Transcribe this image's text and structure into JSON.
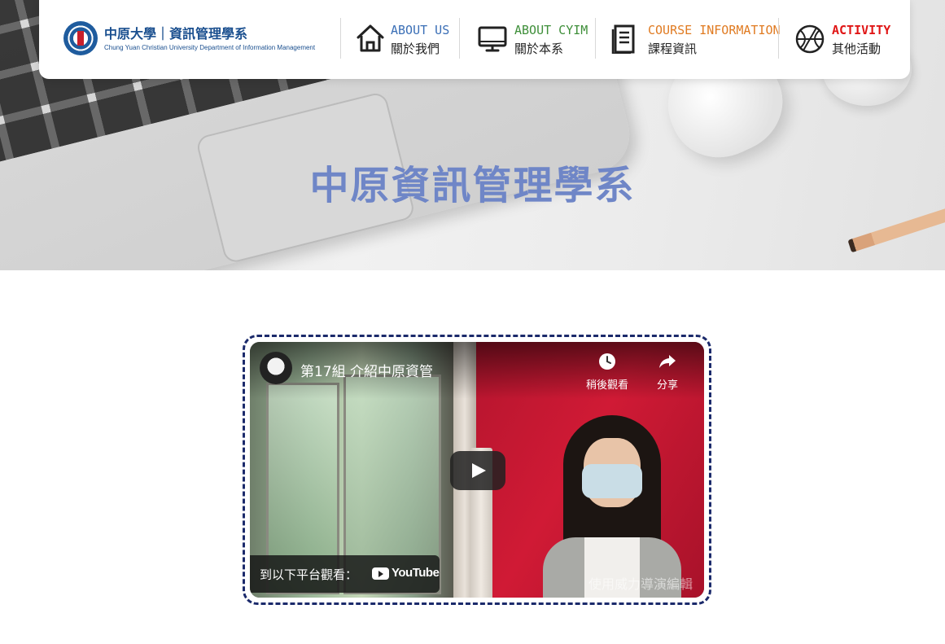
{
  "nav": {
    "logo": {
      "name": "中原大學｜資訊管理學系",
      "subtitle": "Chung Yuan Christian University Department of Information Management"
    },
    "items": [
      {
        "en": "ABOUT US",
        "zh": "關於我們",
        "icon": "home-icon",
        "color": "#3b6fb6"
      },
      {
        "en": "ABOUT CYIM",
        "zh": "關於本系",
        "icon": "monitor-icon",
        "color": "#3f8f3a"
      },
      {
        "en": "COURSE INFORMATION",
        "zh": "課程資訊",
        "icon": "document-icon",
        "color": "#e07b22"
      },
      {
        "en": "ACTIVITY",
        "zh": "其他活動",
        "icon": "basketball-icon",
        "color": "#e01616"
      }
    ]
  },
  "hero": {
    "title": "中原資訊管理學系",
    "title_color": "#6f86c7"
  },
  "video": {
    "title": "第17組 介紹中原資管",
    "watch_later": "稍後觀看",
    "share": "分享",
    "watch_on": "到以下平台觀看：",
    "platform": "YouTube",
    "watermark": "使用威力導演編輯",
    "frame_color": "#1b2a6b"
  }
}
